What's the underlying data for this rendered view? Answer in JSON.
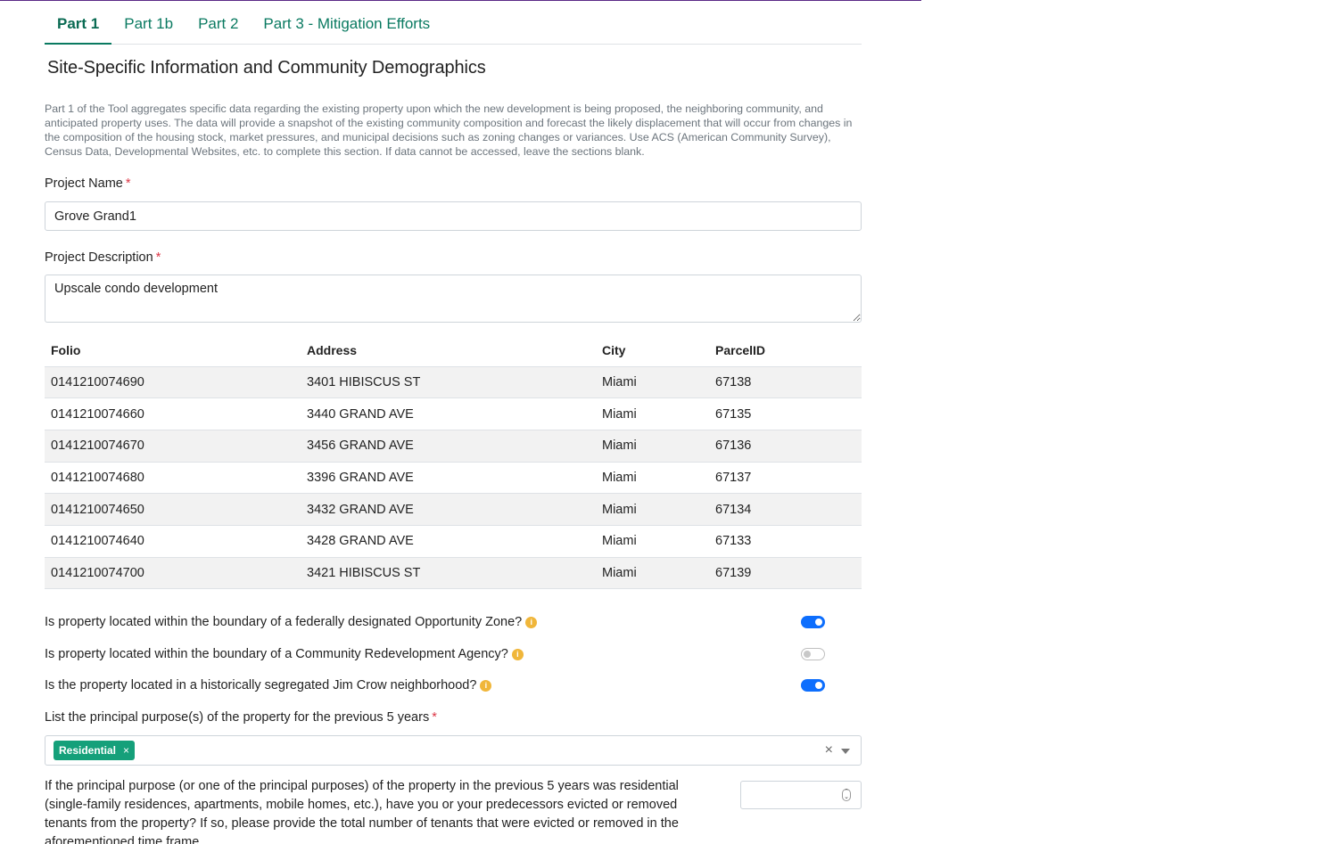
{
  "tabs": [
    {
      "label": "Part 1",
      "active": true
    },
    {
      "label": "Part 1b"
    },
    {
      "label": "Part 2"
    },
    {
      "label": "Part 3 - Mitigation Efforts"
    }
  ],
  "section": {
    "title": "Site-Specific Information and Community Demographics",
    "intro": "Part 1 of the Tool aggregates specific data regarding the existing property upon which the new development is being proposed, the neighboring community, and anticipated property uses. The data will provide a snapshot of the existing community composition and forecast the likely displacement that will occur from changes in the composition of the housing stock, market pressures, and municipal decisions such as zoning changes or variances. Use ACS (American Community Survey), Census Data, Developmental Websites, etc. to complete this section. If data cannot be accessed, leave the sections blank."
  },
  "form": {
    "project_name_label": "Project Name",
    "project_name_value": "Grove Grand1",
    "project_description_label": "Project Description",
    "project_description_value": "Upscale condo development",
    "required_mark": "*"
  },
  "table": {
    "headers": [
      "Folio",
      "Address",
      "City",
      "ParcelID"
    ],
    "rows": [
      [
        "0141210074690",
        "3401 HIBISCUS ST",
        "Miami",
        "67138"
      ],
      [
        "0141210074660",
        "3440 GRAND AVE",
        "Miami",
        "67135"
      ],
      [
        "0141210074670",
        "3456 GRAND AVE",
        "Miami",
        "67136"
      ],
      [
        "0141210074680",
        "3396 GRAND AVE",
        "Miami",
        "67137"
      ],
      [
        "0141210074650",
        "3432 GRAND AVE",
        "Miami",
        "67134"
      ],
      [
        "0141210074640",
        "3428 GRAND AVE",
        "Miami",
        "67133"
      ],
      [
        "0141210074700",
        "3421 HIBISCUS ST",
        "Miami",
        "67139"
      ]
    ]
  },
  "questions": [
    {
      "label": "Is property located within the boundary of a federally designated Opportunity Zone?",
      "value": true
    },
    {
      "label": "Is property located within the boundary of a Community Redevelopment Agency?",
      "value": false
    },
    {
      "label": "Is the property located in a historically segregated Jim Crow neighborhood?",
      "value": true
    }
  ],
  "info_icon": "i",
  "purpose": {
    "label": "List the principal purpose(s) of the property for the previous 5 years",
    "selected": [
      "Residential"
    ],
    "chip_remove": "×",
    "clear": "×"
  },
  "eviction": {
    "label": "If the principal purpose (or one of the principal purposes) of the property in the previous 5 years was residential (single-family residences, apartments, mobile homes, etc.), have you or your predecessors evicted or removed tenants from the property? If so, please provide the total number of tenants that were evicted or removed in the aforementioned time frame",
    "value": ""
  },
  "colors": {
    "accent": "#0a7a61",
    "toggle_on": "#0d6efd",
    "chip": "#15a07a",
    "info": "#f0b63a",
    "required": "#dc3545"
  }
}
